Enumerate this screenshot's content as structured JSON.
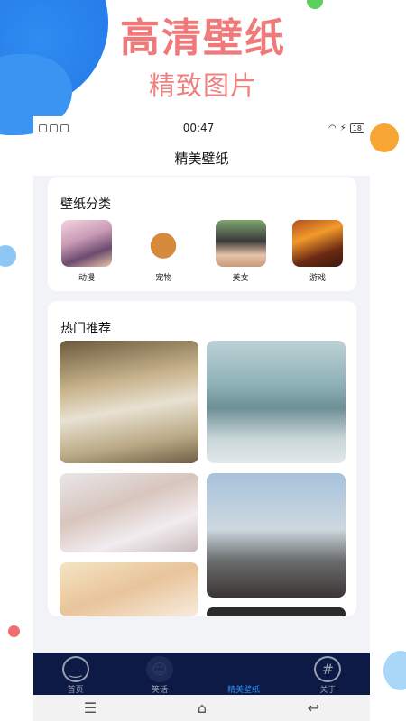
{
  "promo": {
    "headline": "高清壁纸",
    "subheadline": "精致图片"
  },
  "statusbar": {
    "time": "00:47",
    "battery": "18"
  },
  "app": {
    "title": "精美壁纸"
  },
  "categories": {
    "title": "壁纸分类",
    "items": [
      {
        "label": "动漫"
      },
      {
        "label": "宠物"
      },
      {
        "label": "美女"
      },
      {
        "label": "游戏"
      }
    ]
  },
  "hot": {
    "title": "热门推荐"
  },
  "tabbar": {
    "items": [
      {
        "label": "首页",
        "icon": "smile-icon"
      },
      {
        "label": "笑话",
        "icon": "laugh-icon"
      },
      {
        "label": "精美壁纸",
        "icon": "wallpaper-icon"
      },
      {
        "label": "关于",
        "icon": "hash-icon"
      }
    ],
    "active_color": "#2f8cf0",
    "background": "#0d1a45"
  },
  "navbar": {
    "menu": "☰",
    "home": "⌂",
    "back": "↩"
  }
}
